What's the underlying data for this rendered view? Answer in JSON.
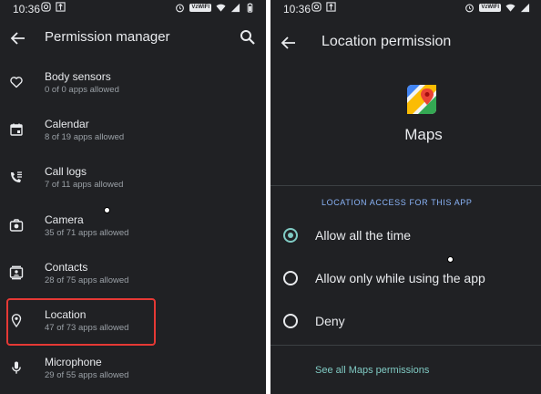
{
  "left": {
    "status": {
      "time": "10:36",
      "wifi_badge": "VzWIFI"
    },
    "title": "Permission manager",
    "permissions": [
      {
        "label": "Body sensors",
        "sub": "0 of 0 apps allowed",
        "icon": "heart-icon"
      },
      {
        "label": "Calendar",
        "sub": "8 of 19 apps allowed",
        "icon": "calendar-icon"
      },
      {
        "label": "Call logs",
        "sub": "7 of 11 apps allowed",
        "icon": "call-log-icon"
      },
      {
        "label": "Camera",
        "sub": "35 of 71 apps allowed",
        "icon": "camera-icon"
      },
      {
        "label": "Contacts",
        "sub": "28 of 75 apps allowed",
        "icon": "contacts-icon"
      },
      {
        "label": "Location",
        "sub": "47 of 73 apps allowed",
        "icon": "location-icon"
      },
      {
        "label": "Microphone",
        "sub": "29 of 55 apps allowed",
        "icon": "microphone-icon"
      }
    ],
    "highlighted": "Location"
  },
  "right": {
    "status": {
      "time": "10:36",
      "wifi_badge": "VzWIFI"
    },
    "title": "Location permission",
    "app_name": "Maps",
    "app_icon": "google-maps-icon",
    "section_header": "LOCATION ACCESS FOR THIS APP",
    "options": [
      {
        "label": "Allow all the time",
        "selected": true
      },
      {
        "label": "Allow only while using the app",
        "selected": false
      },
      {
        "label": "Deny",
        "selected": false
      }
    ],
    "see_all": "See all Maps permissions"
  },
  "colors": {
    "background": "#202124",
    "text_primary": "#e8eaed",
    "text_secondary": "#9aa0a6",
    "accent": "#80cbc4",
    "section_header": "#8ab4f8",
    "highlight": "#e53935"
  }
}
